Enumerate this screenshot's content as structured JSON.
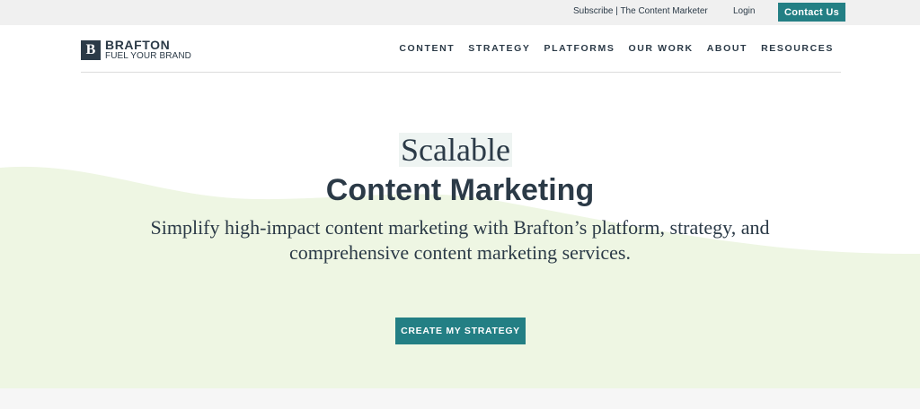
{
  "utility_bar": {
    "subscribe_text": "Subscribe | The Content Marketer",
    "login_text": "Login",
    "contact_label": "Contact Us"
  },
  "header": {
    "logo_mark": "B",
    "logo_name": "BRAFTON",
    "logo_tagline": "FUEL YOUR BRAND",
    "nav": [
      "CONTENT",
      "STRATEGY",
      "PLATFORMS",
      "OUR WORK",
      "ABOUT",
      "RESOURCES"
    ]
  },
  "hero": {
    "title_line1": "Scalable",
    "title_line2": "Content Marketing",
    "subtitle": "Simplify high-impact content marketing with Brafton’s platform, strategy, and comprehensive content marketing services.",
    "cta_label": "CREATE MY STRATEGY"
  },
  "colors": {
    "accent": "#237f84",
    "text": "#2b3a47",
    "hero_wave": "#eef6e3",
    "utility_bg": "#f0f0f0"
  }
}
